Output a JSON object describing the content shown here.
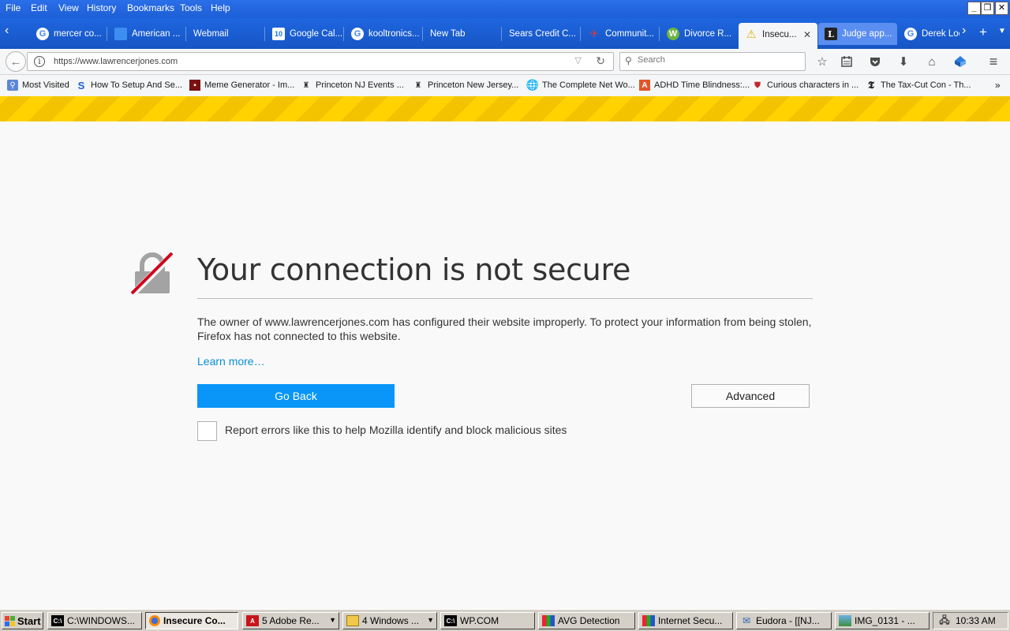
{
  "menu": [
    "File",
    "Edit",
    "View",
    "History",
    "Bookmarks",
    "Tools",
    "Help"
  ],
  "tabs": [
    {
      "label": "mercer co...",
      "icon": "google-icon"
    },
    {
      "label": "American ...",
      "icon": "american-express-icon"
    },
    {
      "label": "Webmail",
      "icon": ""
    },
    {
      "label": "Google Cal...",
      "icon": "google-calendar-icon"
    },
    {
      "label": "kooltronics...",
      "icon": "google-icon"
    },
    {
      "label": "New Tab",
      "icon": ""
    },
    {
      "label": "Sears Credit C...",
      "icon": ""
    },
    {
      "label": "Communit...",
      "icon": "bird-icon"
    },
    {
      "label": "Divorce R...",
      "icon": "wordpress-icon"
    },
    {
      "label": "Insecu...",
      "icon": "warning-icon"
    },
    {
      "label": "Judge app...",
      "icon": "law360-icon"
    },
    {
      "label": "Derek Loe",
      "icon": "google-icon"
    }
  ],
  "calendar_day": "10",
  "url": "https://www.lawrencerjones.com",
  "search_placeholder": "Search",
  "bookmarks": [
    "Most Visited",
    "How To Setup And Se...",
    "Meme Generator - Im...",
    "Princeton NJ Events ...",
    "Princeton New Jersey...",
    "The Complete Net Wo...",
    "ADHD Time Blindness:...",
    "Curious characters in ...",
    "The Tax-Cut Con - Th..."
  ],
  "error": {
    "title": "Your connection is not secure",
    "description": "The owner of www.lawrencerjones.com has configured their website improperly. To protect your information from being stolen, Firefox has not connected to this website.",
    "learn_more": "Learn more…",
    "go_back": "Go Back",
    "advanced": "Advanced",
    "report_label": "Report errors like this to help Mozilla identify and block malicious sites"
  },
  "taskbar": {
    "start": "Start",
    "items": [
      "C:\\WINDOWS...",
      "Insecure Co...",
      "5 Adobe Re...",
      "4 Windows ...",
      "WP.COM",
      "AVG Detection",
      "Internet Secu...",
      "Eudora - [[NJ...",
      "IMG_0131 - ..."
    ],
    "clock": "10:33 AM"
  },
  "colors": {
    "primary_button": "#0996f8",
    "link": "#0a8dd1",
    "warning_stripe": "#ffd200",
    "titlebar": "#1f66e0"
  }
}
